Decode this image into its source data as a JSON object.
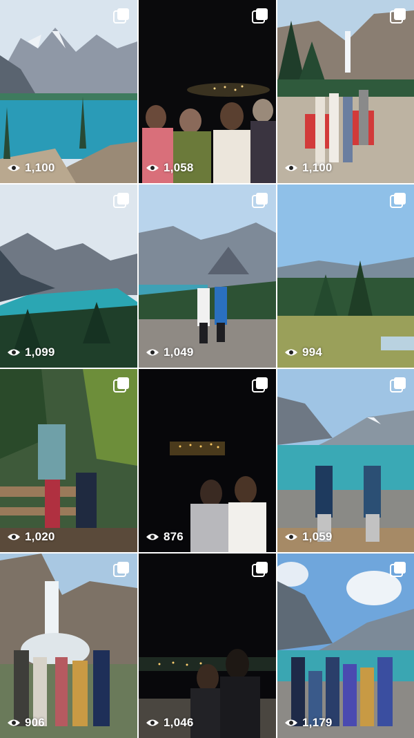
{
  "grid": {
    "posts": [
      {
        "views": "1,100",
        "scene": "moraine-lake",
        "multi": true
      },
      {
        "views": "1,058",
        "scene": "night-group-four",
        "multi": true
      },
      {
        "views": "1,100",
        "scene": "waterfall-red-chairs",
        "multi": true
      },
      {
        "views": "1,099",
        "scene": "peyto-lake",
        "multi": true
      },
      {
        "views": "1,049",
        "scene": "mountain-couple",
        "multi": true
      },
      {
        "views": "994",
        "scene": "forest-valley",
        "multi": true
      },
      {
        "views": "1,020",
        "scene": "river-bridge-pose",
        "multi": true
      },
      {
        "views": "876",
        "scene": "night-hotel-pair",
        "multi": true
      },
      {
        "views": "1,059",
        "scene": "lake-louise-pose",
        "multi": true
      },
      {
        "views": "906",
        "scene": "takakkaw-group",
        "multi": true
      },
      {
        "views": "1,046",
        "scene": "night-couple",
        "multi": true
      },
      {
        "views": "1,179",
        "scene": "lake-louise-group",
        "multi": true
      }
    ]
  },
  "icons": {
    "views": "eye-icon",
    "multi": "multiple-photos-icon"
  }
}
